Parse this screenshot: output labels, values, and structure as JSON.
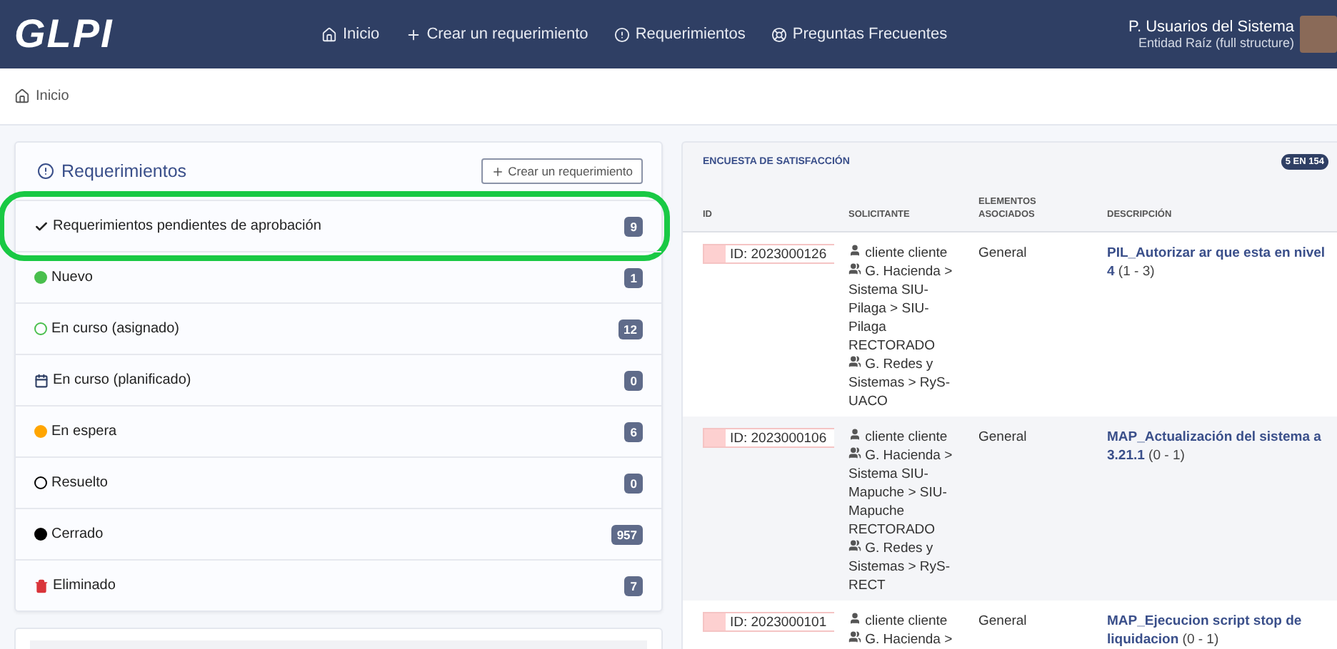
{
  "header": {
    "logo": "GLPI",
    "nav": [
      {
        "label": "Inicio"
      },
      {
        "label": "Crear un requerimiento"
      },
      {
        "label": "Requerimientos"
      },
      {
        "label": "Preguntas Frecuentes"
      }
    ],
    "user": {
      "name": "P. Usuarios del Sistema",
      "entity": "Entidad Raíz (full structure)"
    }
  },
  "breadcrumb": "Inicio",
  "tickets_card": {
    "title": "Requerimientos",
    "create_button": "Crear un requerimiento",
    "items": [
      {
        "kind": "check",
        "label": "Requerimientos pendientes de aprobación",
        "count": "9",
        "highlighted": true
      },
      {
        "kind": "dot",
        "color": "#49bf4d",
        "label": "Nuevo",
        "count": "1",
        "highlighted": false
      },
      {
        "kind": "ring",
        "color": "#49bf4d",
        "label": "En curso (asignado)",
        "count": "12",
        "highlighted": false
      },
      {
        "kind": "calendar",
        "label": "En curso (planificado)",
        "count": "0",
        "highlighted": false
      },
      {
        "kind": "dot",
        "color": "#ffa500",
        "label": "En espera",
        "count": "6",
        "highlighted": false
      },
      {
        "kind": "ring",
        "color": "#000000",
        "label": "Resuelto",
        "count": "0",
        "highlighted": false
      },
      {
        "kind": "dot",
        "color": "#000000",
        "label": "Cerrado",
        "count": "957",
        "highlighted": false
      },
      {
        "kind": "trash",
        "label": "Eliminado",
        "count": "7",
        "highlighted": false
      }
    ]
  },
  "survey_card": {
    "title": "ENCUESTA DE SATISFACCIÓN",
    "badge": "5 EN 154",
    "columns": [
      "ID",
      "SOLICITANTE",
      "ELEMENTOS ASOCIADOS",
      "DESCRIPCIÓN"
    ],
    "rows": [
      {
        "id": "ID: 2023000126",
        "requesters": [
          {
            "kind": "user",
            "text": "cliente cliente"
          },
          {
            "kind": "group",
            "text": "G. Hacienda > Sistema SIU-Pilaga > SIU-Pilaga RECTORADO"
          },
          {
            "kind": "group",
            "text": "G. Redes y Sistemas > RyS-UACO"
          }
        ],
        "items": "General",
        "description": "**PIL_Autorizar ar que esta en nivel 4** (1 - 3)"
      },
      {
        "id": "ID: 2023000106",
        "requesters": [
          {
            "kind": "user",
            "text": "cliente cliente"
          },
          {
            "kind": "group",
            "text": "G. Hacienda > Sistema SIU-Mapuche > SIU-Mapuche RECTORADO"
          },
          {
            "kind": "group",
            "text": "G. Redes y Sistemas > RyS-RECT"
          }
        ],
        "items": "General",
        "description": "**MAP_Actualización del sistema a 3.21.1** (0 - 1)"
      },
      {
        "id": "ID: 2023000101",
        "requesters": [
          {
            "kind": "user",
            "text": "cliente cliente"
          },
          {
            "kind": "group",
            "text": "G. Hacienda >"
          }
        ],
        "items": "General",
        "description": "**MAP_Ejecucion script stop de liquidacion** (0 - 1)"
      }
    ]
  }
}
